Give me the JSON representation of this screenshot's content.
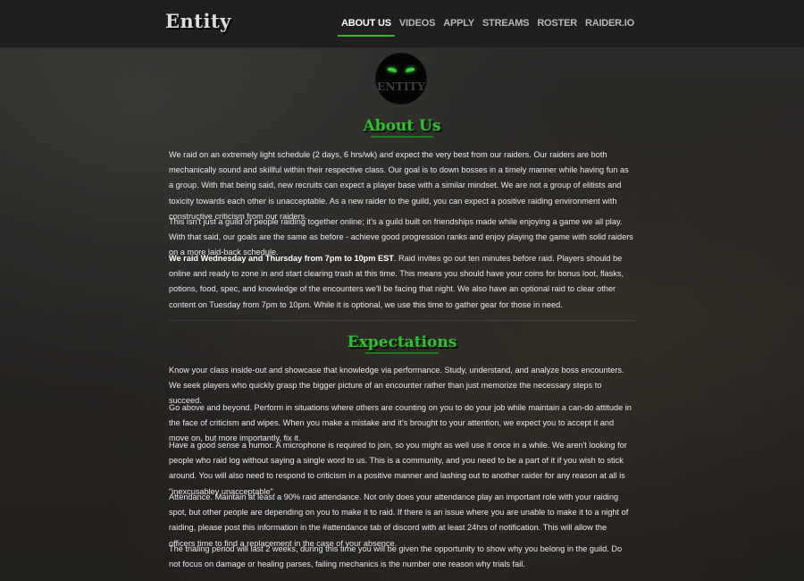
{
  "brand": {
    "name": "Entity"
  },
  "nav": {
    "items": [
      {
        "label": "ABOUT US",
        "active": true
      },
      {
        "label": "VIDEOS",
        "active": false
      },
      {
        "label": "APPLY",
        "active": false
      },
      {
        "label": "STREAMS",
        "active": false
      },
      {
        "label": "ROSTER",
        "active": false
      },
      {
        "label": "RAIDER.IO",
        "active": false
      }
    ]
  },
  "logo": {
    "text": "ENTITY"
  },
  "about": {
    "title": "About Us",
    "p1": "We raid on an extremely light schedule (2 days, 6 hrs/wk) and expect the very best from our raiders. Our raiders are both mechanically sound and skillful within their respective class. Our goal is to down bosses in a timely manner while having fun as a group. With that being said, new recruits can expect a player base with a similar mindset. We are not a group of elitists and toxicity towards each other is unacceptable. As a new raider to the guild, you can expect a positive raiding environment with constructive criticism from our raiders.",
    "p2": "This isn't just a guild of people raiding together online; it's a guild built on friendships made while enjoying a game we all play. With that said, our goals are the same as before - achieve good progression ranks and enjoy playing the game with solid raiders on a more laid-back schedule.",
    "p3_bold": "We raid Wednesday and Thursday from 7pm to 10pm EST",
    "p3_rest": ". Raid invites go out ten minutes before raid. Players should be online and ready to zone in and start clearing trash at this time. This means you should have your coins for bonus loot, flasks, potions, food, spec, and knowledge of the encounters we'll be facing that night. We also have an optional raid to clear other content on Tuesday from 7pm to 10pm. While it is optional, we use this time to gather gear for those in need."
  },
  "expectations": {
    "title": "Expectations",
    "p1": "Know your class inside-out and showcase that knowledge via performance. Study, understand, and analyze boss encounters. We seek players who quickly grasp the bigger picture of an encounter rather than just memorize the necessary steps to succeed.",
    "p2": "Go above and beyond. Perform in situations where others are counting on you to do your job while maintain a can-do attitude in the face of criticism and wipes. When you make a mistake and it's brought to your attention, we expect you to accept it and move on, but more importantly, fix it.",
    "p3": "Have a good sense a humor. A microphone is required to join, so you might as well use it once in a while. We aren't looking for people who raid log without saying a single word to us. This is a community, and you need to be a part of it if you wish to stick around. You will also need to respond to criticism in a positive manner and lashing out to another raider for any reason at all is \"inexcusabley unacceptable\".",
    "p4": "Attendance. Maintain at least a 90% raid attendance. Not only does your attendance play an important role with your raiding spot, but other people are depending on you to make it to raid. If there is an issue where you are unable to make it to a night of raiding, please post this information in the #attendance tab of discord with at least 24hrs of notification. This will allow the officers time to find a replacement in the case of your absence.",
    "p5": "The trialing period will last 2 weeks, during this time you will be given the opportunity to show why you belong in the guild. Do not focus on damage or healing parses, failing mechanics is the number one reason why trials fail."
  }
}
